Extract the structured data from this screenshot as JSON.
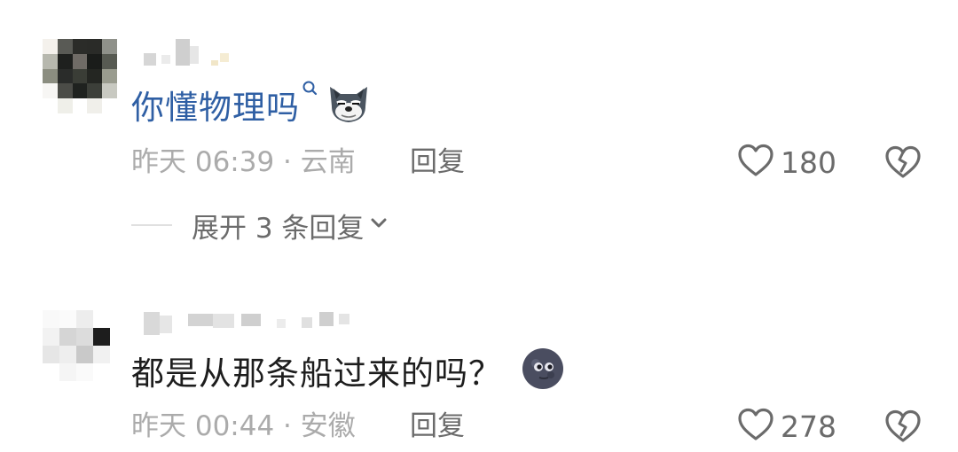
{
  "comments": [
    {
      "text": "你懂物理吗",
      "time_location": "昨天 06:39 · 云南",
      "reply_label": "回复",
      "like_count": "180",
      "expand_label": "展开 3 条回复",
      "emoji_icon": "wolf-face-icon"
    },
    {
      "text": "都是从那条船过来的吗？",
      "time_location": "昨天 00:44 · 安徽",
      "reply_label": "回复",
      "like_count": "278",
      "emoji_icon": "new-moon-face-icon"
    }
  ],
  "colors": {
    "link_text": "#2f5fa4",
    "body_text": "#1d1d1d",
    "meta_text": "#ababab",
    "action_text": "#6b6b6b"
  }
}
